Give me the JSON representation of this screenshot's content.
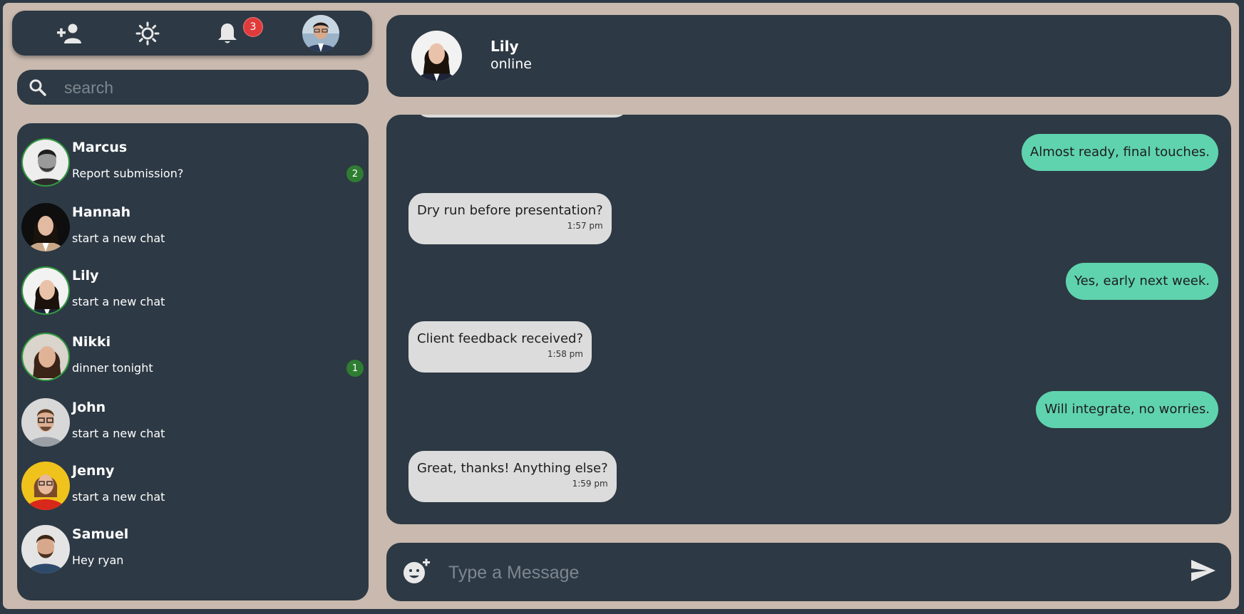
{
  "topbar": {
    "icons": [
      "add-user-icon",
      "brightness-icon",
      "bell-icon"
    ],
    "notification_count": "3"
  },
  "search": {
    "placeholder": "search"
  },
  "contacts": [
    {
      "name": "Marcus",
      "last_message": "Report submission?",
      "unread": "2",
      "online": true
    },
    {
      "name": "Hannah",
      "last_message": "start a new chat",
      "unread": "",
      "online": false
    },
    {
      "name": "Lily",
      "last_message": "start a new chat",
      "unread": "",
      "online": true
    },
    {
      "name": "Nikki",
      "last_message": "dinner tonight",
      "unread": "1",
      "online": true
    },
    {
      "name": "John",
      "last_message": "start a new chat",
      "unread": "",
      "online": false
    },
    {
      "name": "Jenny",
      "last_message": "start a new chat",
      "unread": "",
      "online": false
    },
    {
      "name": "Samuel",
      "last_message": "Hey ryan",
      "unread": "",
      "online": false
    }
  ],
  "chat": {
    "contact_name": "Lily",
    "status": "online",
    "messages": [
      {
        "dir": "sent",
        "text": "Almost ready, final touches."
      },
      {
        "dir": "recv",
        "text": "Dry run before presentation?",
        "time": "1:57 pm"
      },
      {
        "dir": "sent",
        "text": "Yes, early next week."
      },
      {
        "dir": "recv",
        "text": "Client feedback received?",
        "time": "1:58 pm"
      },
      {
        "dir": "sent",
        "text": "Will integrate, no worries."
      },
      {
        "dir": "recv",
        "text": "Great, thanks! Anything else?",
        "time": "1:59 pm"
      }
    ]
  },
  "composer": {
    "placeholder": "Type a Message"
  },
  "colors": {
    "panel": "#2d3944",
    "background": "#c9b9ae",
    "sent_bubble": "#5fd3ad",
    "recv_bubble": "#dcdcdc",
    "notification_badge": "#e03b3b",
    "unread_badge": "#2f7d32",
    "online_ring": "#2e9a3c"
  }
}
